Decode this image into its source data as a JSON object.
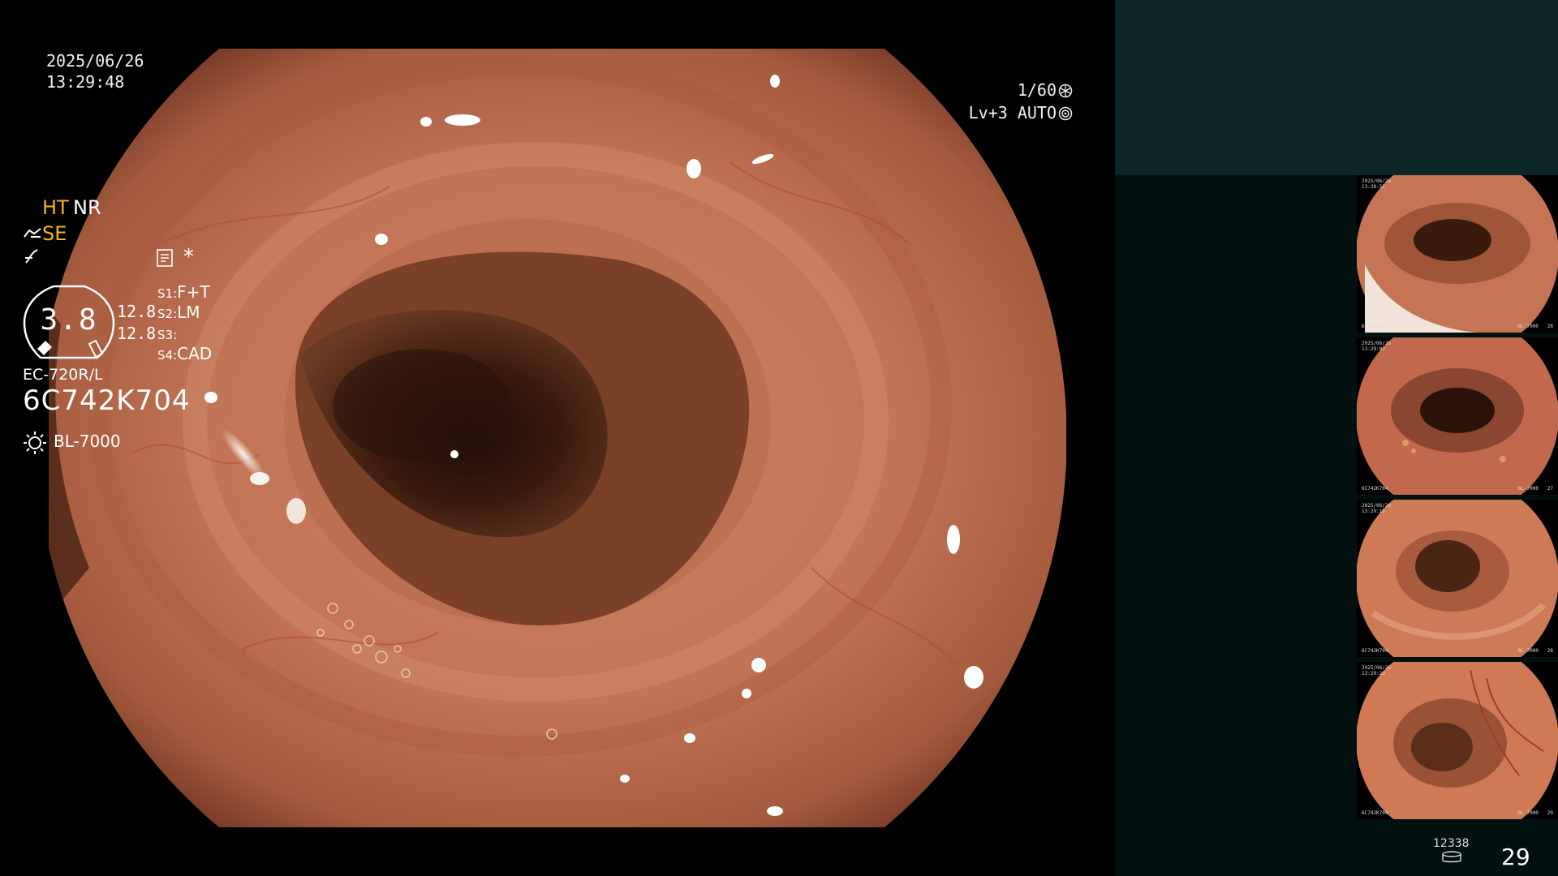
{
  "view": {
    "date": "2025/06/26",
    "time": "13:29:48",
    "shutter": "1/60",
    "shutter_icon": "aperture-icon",
    "level": "Lv+3",
    "mode": "AUTO",
    "mode_icon": "iris-icon"
  },
  "panel": {
    "ht": "HT",
    "nr": "NR",
    "se": "SE",
    "structure_icon": "structure-enhance-icon",
    "enhance_icon": "enhancement-icon",
    "memo_icon": "memo-icon",
    "star": "*",
    "gauge_value": "3.8",
    "format_1": "12.8",
    "format_2": "12.8",
    "switches": [
      {
        "key": "S1",
        "value": "F+T"
      },
      {
        "key": "S2",
        "value": "LM"
      },
      {
        "key": "S3",
        "value": ""
      },
      {
        "key": "S4",
        "value": "CAD"
      }
    ],
    "scope_model": "EC-720R/L",
    "scope_serial": "6C742K704",
    "light_icon": "light-source-icon",
    "light_source": "BL-7000",
    "storage_icon": "storage-icon",
    "storage_count": "12338",
    "image_count": "29"
  },
  "thumbnails": [
    {
      "date": "2025/06/26",
      "time": "13:28:51",
      "serial": "6C742K704",
      "light": "BL-7000",
      "count": "26"
    },
    {
      "date": "2025/06/26",
      "time": "13:29:02",
      "serial": "6C742K704",
      "light": "BL-7000",
      "count": "27"
    },
    {
      "date": "2025/06/26",
      "time": "13:29:15",
      "serial": "6C742K704",
      "light": "BL-7000",
      "count": "28"
    },
    {
      "date": "2025/06/26",
      "time": "13:29:29",
      "serial": "6C742K704",
      "light": "BL-7000",
      "count": "29"
    }
  ],
  "colors": {
    "panel_bg": "#02100f",
    "panel_top": "#0c2628",
    "accent_yellow": "#f6b21a",
    "tissue": "#c9785a"
  }
}
